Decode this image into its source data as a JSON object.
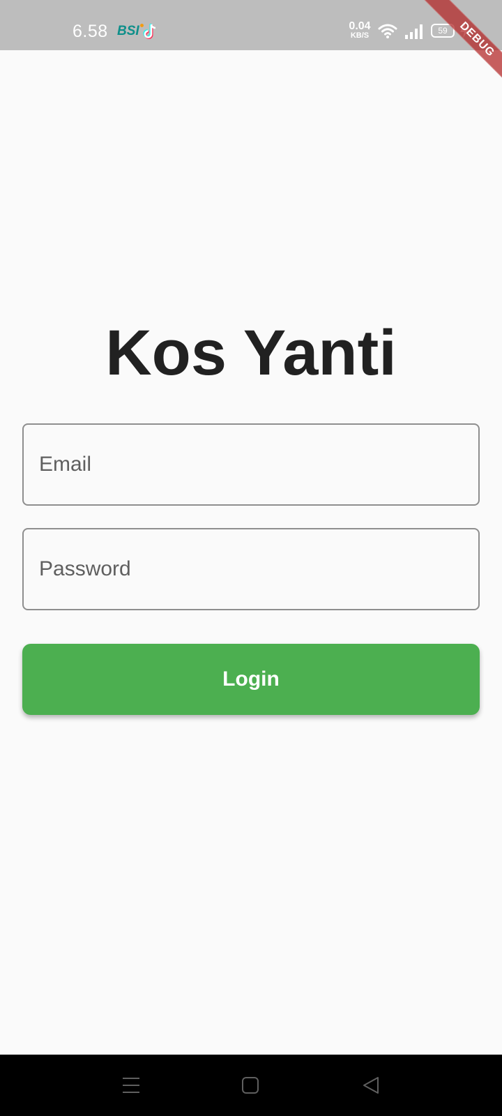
{
  "status_bar": {
    "time": "6.58",
    "notification_icons": [
      "bsi-icon",
      "tiktok-icon"
    ],
    "bsi_label": "BSI",
    "net_speed_value": "0.04",
    "net_speed_unit": "KB/S",
    "battery_level": "59",
    "icons": [
      "wifi-icon",
      "signal-icon",
      "battery-icon",
      "charging-icon"
    ]
  },
  "debug_banner": {
    "label": "DEBUG"
  },
  "login": {
    "title": "Kos Yanti",
    "email_placeholder": "Email",
    "email_value": "",
    "password_placeholder": "Password",
    "password_value": "",
    "login_label": "Login"
  },
  "nav_bar": {
    "icons": [
      "menu-icon",
      "home-icon",
      "back-icon"
    ]
  },
  "colors": {
    "status_bar": "#BDBDBD",
    "background": "#FAFAFA",
    "title": "#212121",
    "field_border": "#8E8E8E",
    "button": "#4CAF50",
    "button_text": "#FFFFFF",
    "debug_banner": "#B22222",
    "nav_bar": "#000000"
  }
}
